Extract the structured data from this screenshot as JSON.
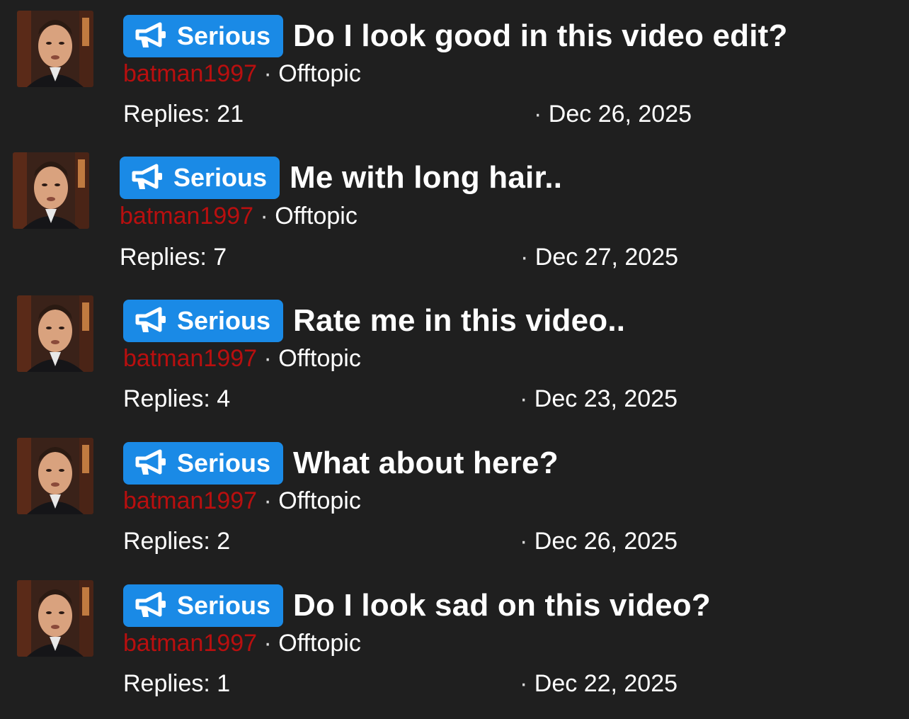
{
  "colors": {
    "background": "#1f1f1f",
    "badge": "#1a8ae6",
    "author": "#b80f0f",
    "text": "#ffffff"
  },
  "threads": [
    {
      "prefix": "Serious",
      "prefix_icon": "megaphone-icon",
      "title": "Do I look good in this video edit?",
      "author": "batman1997",
      "separator": "·",
      "forum": "Offtopic",
      "replies_label": "Replies:",
      "replies": "21",
      "date_separator": "·",
      "date": "Dec 26, 2025"
    },
    {
      "prefix": "Serious",
      "prefix_icon": "megaphone-icon",
      "title": "Me with long hair..",
      "author": "batman1997",
      "separator": "·",
      "forum": "Offtopic",
      "replies_label": "Replies:",
      "replies": "7",
      "date_separator": "·",
      "date": "Dec 27, 2025"
    },
    {
      "prefix": "Serious",
      "prefix_icon": "megaphone-icon",
      "title": "Rate me in this video..",
      "author": "batman1997",
      "separator": "·",
      "forum": "Offtopic",
      "replies_label": "Replies:",
      "replies": "4",
      "date_separator": "·",
      "date": "Dec 23, 2025"
    },
    {
      "prefix": "Serious",
      "prefix_icon": "megaphone-icon",
      "title": "What about here?",
      "author": "batman1997",
      "separator": "·",
      "forum": "Offtopic",
      "replies_label": "Replies:",
      "replies": "2",
      "date_separator": "·",
      "date": "Dec 26, 2025"
    },
    {
      "prefix": "Serious",
      "prefix_icon": "megaphone-icon",
      "title": "Do I look sad on this video?",
      "author": "batman1997",
      "separator": "·",
      "forum": "Offtopic",
      "replies_label": "Replies:",
      "replies": "1",
      "date_separator": "·",
      "date": "Dec 22, 2025"
    }
  ]
}
